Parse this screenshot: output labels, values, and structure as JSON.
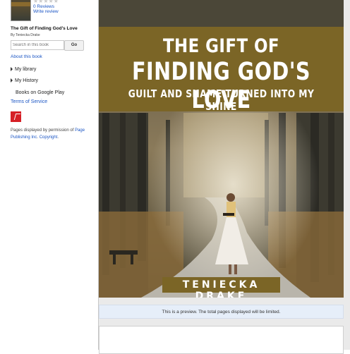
{
  "sidebar": {
    "rating_stars": "★★★★★",
    "reviews_label": "0 Reviews",
    "write_review_label": "Write review",
    "book_title": "The Gift of Finding God's Love",
    "byline": "By Teniecka Drake",
    "search_placeholder": "Search in this book",
    "go_label": "Go",
    "about_label": "About this book",
    "my_library_label": "My library",
    "my_history_label": "My History",
    "books_on_google_play_label": "Books on Google Play",
    "terms_label": "Terms of Service",
    "permission_text": "Pages displayed by permission of ",
    "publisher_link": "Page Publishing Inc",
    "copyright_link": "Copyright"
  },
  "viewer": {
    "cover_line1": "THE GIFT OF",
    "cover_line2": "FINDING GOD'S LOVE",
    "cover_line3": "GUILT AND SHAME TURNED INTO MY SHINE",
    "cover_author": "TENIECKA DRAKE",
    "preview_notice": "This is a preview. The total pages displayed will be limited."
  },
  "colors": {
    "link": "#1a55c4",
    "title_band": "#7b6526",
    "preview_bar": "#e6eef9"
  }
}
